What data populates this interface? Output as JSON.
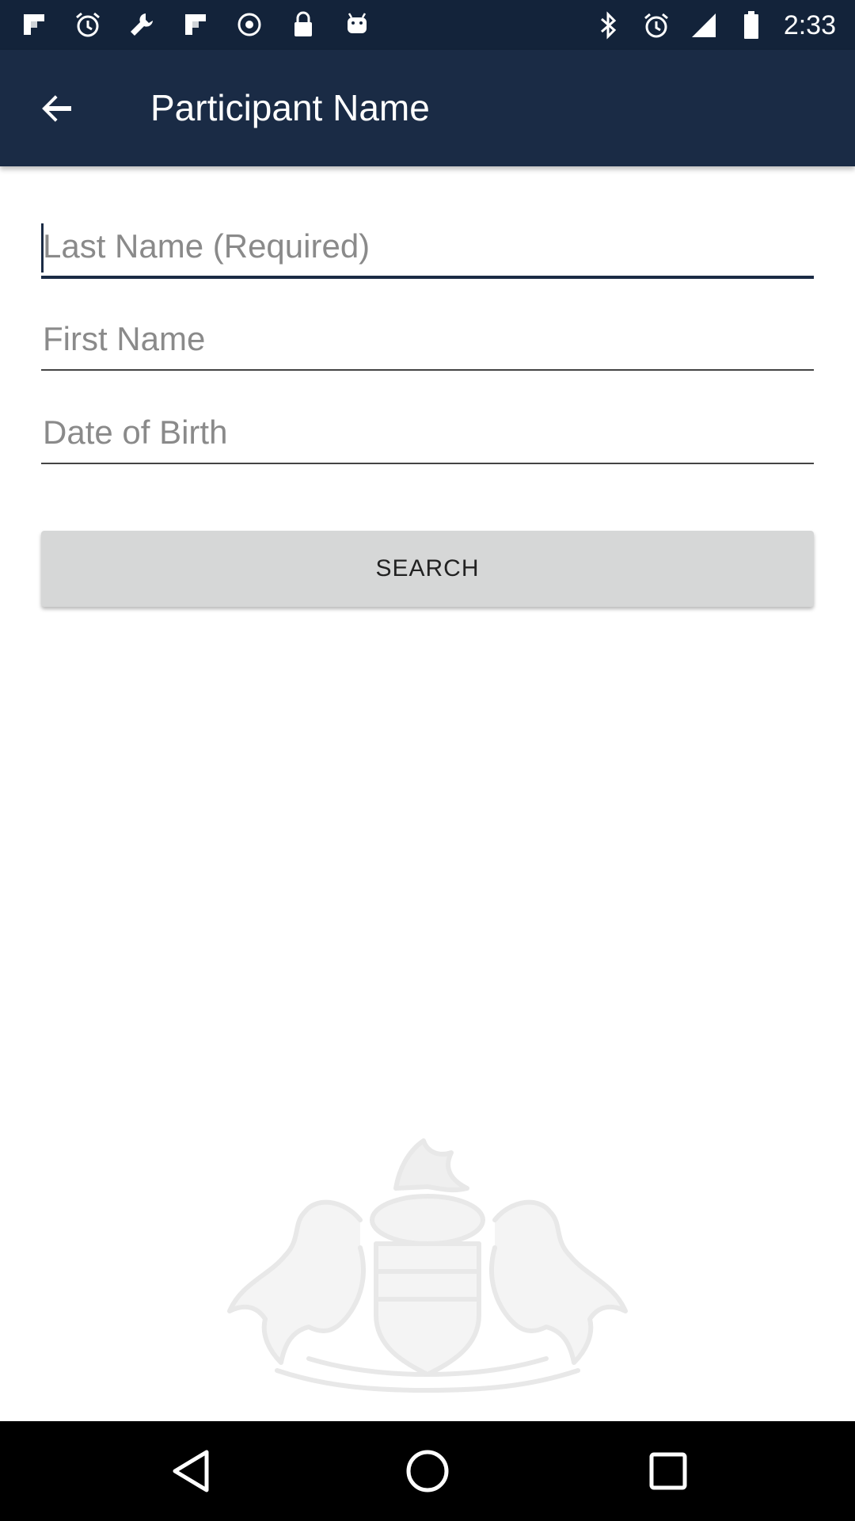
{
  "status_bar": {
    "time": "2:33",
    "left_icons": [
      "flipboard-icon",
      "alarm-icon",
      "wrench-icon",
      "flipboard-icon",
      "podcast-icon",
      "lock-icon",
      "android-icon"
    ],
    "right_icons": [
      "bluetooth-icon",
      "alarm-icon",
      "signal-icon",
      "battery-icon"
    ]
  },
  "app_bar": {
    "title": "Participant Name"
  },
  "form": {
    "last_name_placeholder": "Last Name (Required)",
    "first_name_placeholder": "First Name",
    "dob_placeholder": "Date of Birth",
    "search_label": "SEARCH"
  },
  "colors": {
    "app_bar": "#1a2b45",
    "status_bar": "#13233a",
    "button_bg": "#d6d7d7"
  }
}
